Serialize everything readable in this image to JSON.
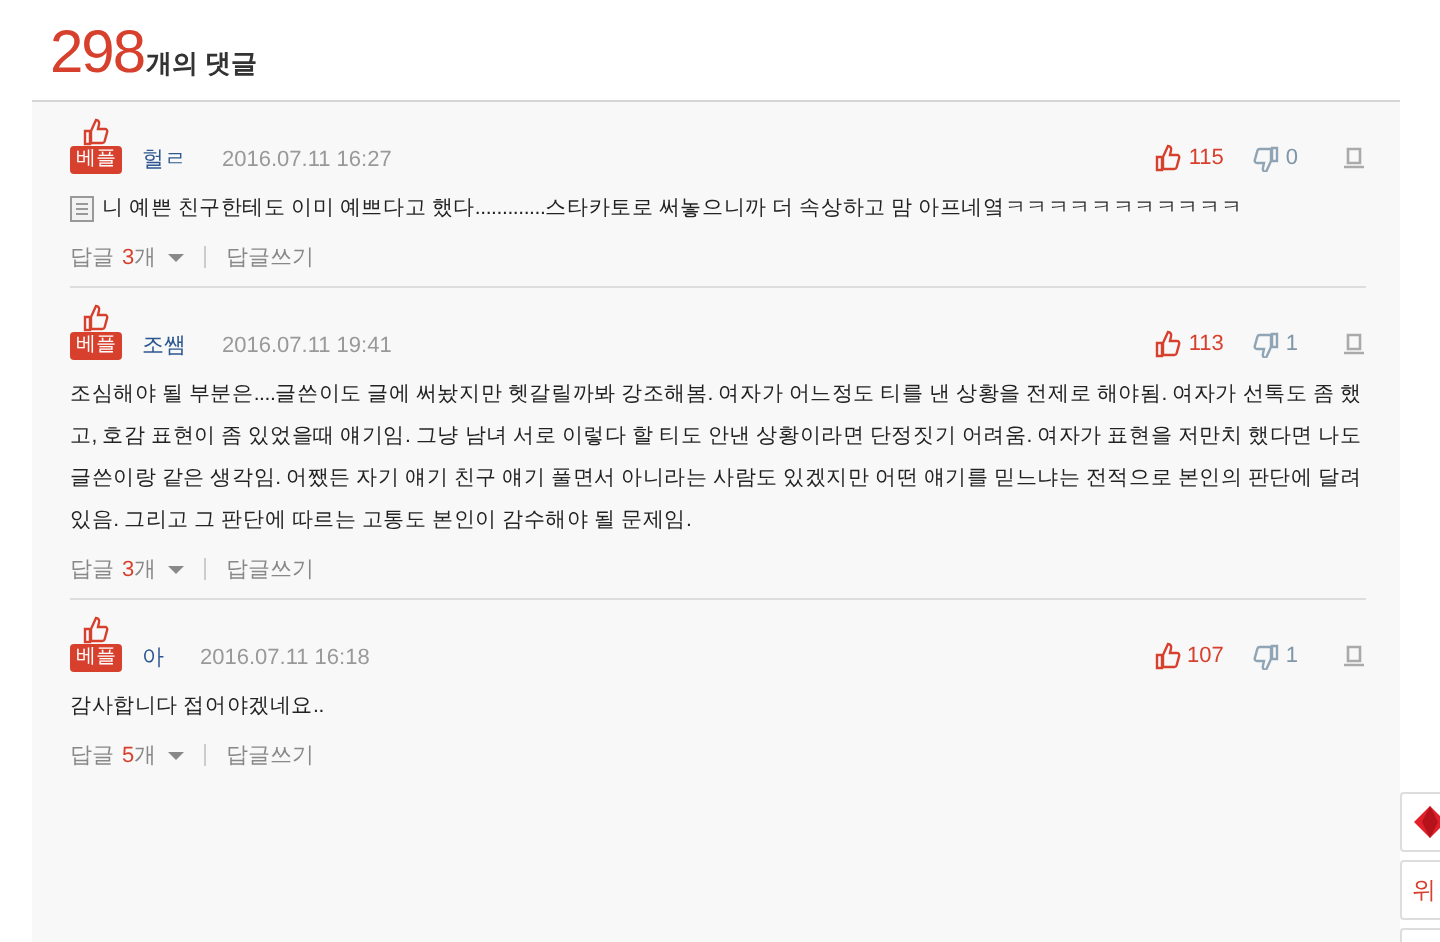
{
  "header": {
    "count": "298",
    "label": "개의 댓글"
  },
  "comments": [
    {
      "badge": "베플",
      "author": "헐ㄹ",
      "date": "2016.07.11 16:27",
      "likes": "115",
      "dislikes": "0",
      "has_icon": true,
      "text": "니 예쁜 친구한테도 이미 예쁘다고 했다.............스타카토로 써놓으니까 더 속상하고 맘 아프네옄ㅋㅋㅋㅋㅋㅋㅋㅋㅋㅋㅋ",
      "replies": {
        "prefix": "답글",
        "count": "3",
        "suffix": "개"
      },
      "write": "답글쓰기"
    },
    {
      "badge": "베플",
      "author": "조쌤",
      "date": "2016.07.11 19:41",
      "likes": "113",
      "dislikes": "1",
      "has_icon": false,
      "text": "조심해야 될 부분은....글쓴이도 글에 써놨지만 헷갈릴까봐 강조해봄. 여자가 어느정도 티를 낸 상황을 전제로 해야됨. 여자가 선톡도 좀 했고, 호감 표현이 좀 있었을때 얘기임. 그냥 남녀 서로 이렇다 할 티도 안낸 상황이라면 단정짓기 어려움. 여자가 표현을 저만치 했다면 나도 글쓴이랑 같은 생각임. 어쨌든 자기 얘기 친구 얘기 풀면서 아니라는 사람도 있겠지만 어떤 얘기를 믿느냐는 전적으로 본인의 판단에 달려있음. 그리고 그 판단에 따르는 고통도 본인이 감수해야 될 문제임.",
      "replies": {
        "prefix": "답글",
        "count": "3",
        "suffix": "개"
      },
      "write": "답글쓰기"
    },
    {
      "badge": "베플",
      "author": "아",
      "date": "2016.07.11 16:18",
      "likes": "107",
      "dislikes": "1",
      "has_icon": false,
      "text": "감사합니다 접어야겠네요..",
      "replies": {
        "prefix": "답글",
        "count": "5",
        "suffix": "개"
      },
      "write": "답글쓰기"
    }
  ],
  "side_buttons": [
    {
      "kind": "icon"
    },
    {
      "kind": "text",
      "label": "위"
    },
    {
      "kind": "blank"
    }
  ]
}
